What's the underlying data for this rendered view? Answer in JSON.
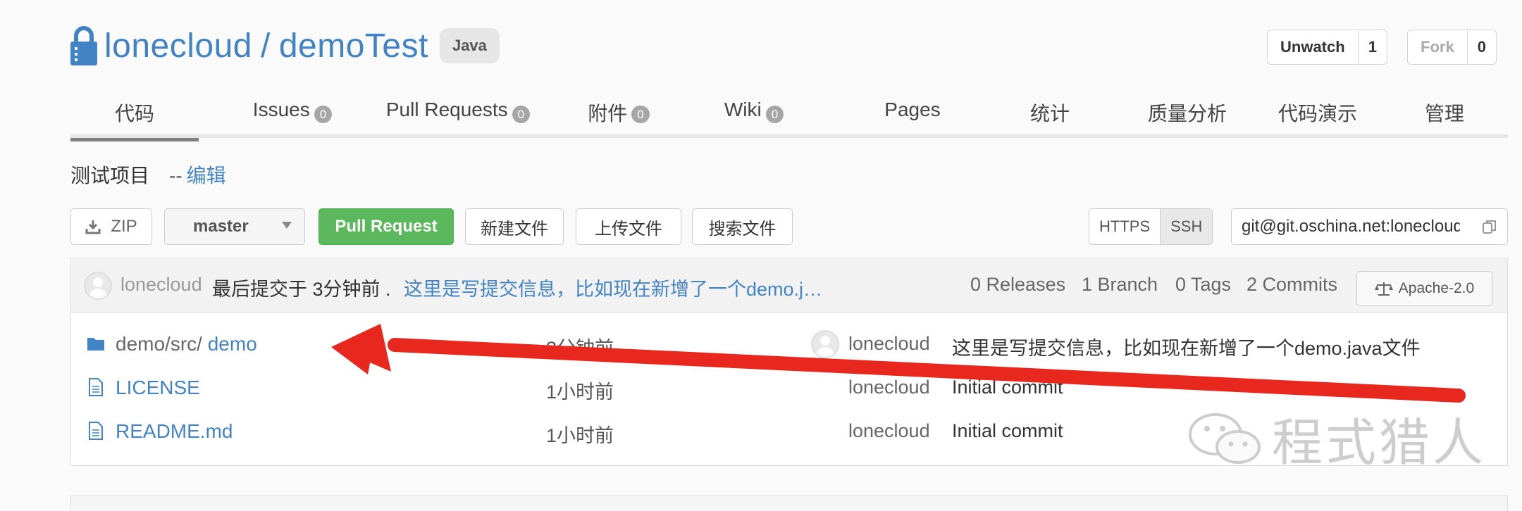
{
  "repo": {
    "owner": "lonecloud",
    "separator": "/",
    "name": "demoTest",
    "language": "Java"
  },
  "watch": {
    "label": "Unwatch",
    "count": "1"
  },
  "fork": {
    "label": "Fork",
    "count": "0"
  },
  "tabs": [
    {
      "label": "代码",
      "active": true
    },
    {
      "label": "Issues",
      "badge": "0"
    },
    {
      "label": "Pull Requests",
      "badge": "0"
    },
    {
      "label": "附件",
      "badge": "0"
    },
    {
      "label": "Wiki",
      "badge": "0"
    },
    {
      "label": "Pages"
    },
    {
      "label": "统计"
    },
    {
      "label": "质量分析"
    },
    {
      "label": "代码演示"
    },
    {
      "label": "管理"
    }
  ],
  "description": {
    "text": "测试项目",
    "edit_prefix": "--",
    "edit_label": "编辑"
  },
  "toolbar": {
    "zip_label": "ZIP",
    "branch": "master",
    "pull_request_label": "Pull Request",
    "new_file_label": "新建文件",
    "upload_label": "上传文件",
    "search_label": "搜索文件",
    "https_label": "HTTPS",
    "ssh_label": "SSH",
    "clone_url": "git@git.oschina.net:lonecloud/demoTest.git"
  },
  "commit_bar": {
    "user": "lonecloud",
    "last_commit": "最后提交于 3分钟前 .",
    "message": "这里是写提交信息，比如现在新增了一个demo.j…",
    "releases": "0 Releases",
    "branches": "1 Branch",
    "tags": "0 Tags",
    "commits": "2 Commits",
    "license": "Apache-2.0"
  },
  "files": [
    {
      "type": "folder",
      "path_prefix": "demo/src/",
      "name": "demo",
      "time": "3分钟前",
      "user": "lonecloud",
      "message": "这里是写提交信息，比如现在新增了一个demo.java文件",
      "show_avatar": true
    },
    {
      "type": "file",
      "path_prefix": "",
      "name": "LICENSE",
      "time": "1小时前",
      "user": "lonecloud",
      "message": "Initial commit",
      "show_avatar": false
    },
    {
      "type": "file",
      "path_prefix": "",
      "name": "README.md",
      "time": "1小时前",
      "user": "lonecloud",
      "message": "Initial commit",
      "show_avatar": false
    }
  ],
  "watermark": "程式猎人",
  "colors": {
    "link": "#4183c4",
    "primary_button": "#5cb85c",
    "arrow": "#e8281e"
  }
}
